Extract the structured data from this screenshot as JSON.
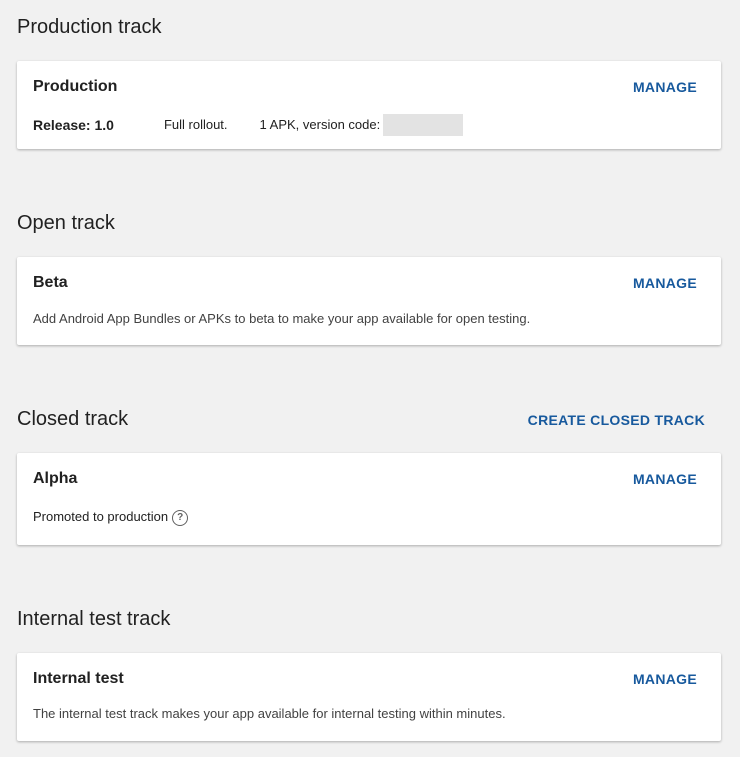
{
  "sections": {
    "production": {
      "title": "Production track",
      "card": {
        "title": "Production",
        "manage": "MANAGE",
        "release_label": "Release: 1.0",
        "rollout": "Full rollout.",
        "apk_info": "1 APK, version code:"
      }
    },
    "open": {
      "title": "Open track",
      "card": {
        "title": "Beta",
        "manage": "MANAGE",
        "description": "Add Android App Bundles or APKs to beta to make your app available for open testing."
      }
    },
    "closed": {
      "title": "Closed track",
      "create_button": "CREATE CLOSED TRACK",
      "card": {
        "title": "Alpha",
        "manage": "MANAGE",
        "status": "Promoted to production",
        "help_icon_glyph": "?"
      }
    },
    "internal": {
      "title": "Internal test track",
      "card": {
        "title": "Internal test",
        "manage": "MANAGE",
        "description": "The internal test track makes your app available for internal testing within minutes."
      }
    }
  },
  "colors": {
    "accent": "#17599d",
    "background": "#f1f1f1",
    "card": "#ffffff"
  }
}
